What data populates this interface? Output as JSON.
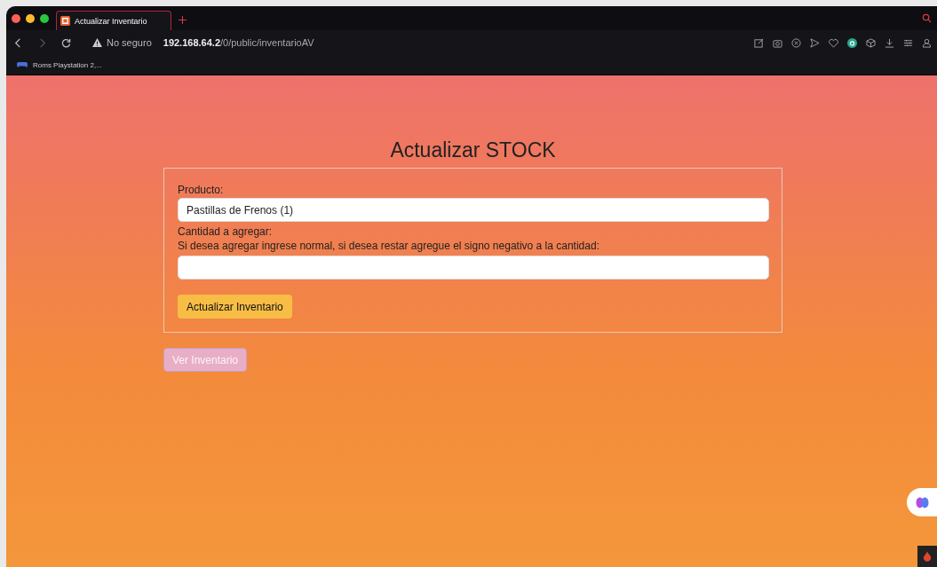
{
  "browser": {
    "tab": {
      "title": "Actualizar Inventario",
      "selected": true
    },
    "security": "No seguro",
    "url_host": "192.168.64.2",
    "url_path": "/0/public/inventarioAV",
    "bookmarks": [
      {
        "label": "Roms Playstation 2,..."
      }
    ]
  },
  "page": {
    "heading": "Actualizar STOCK",
    "form": {
      "product_label": "Producto:",
      "product_value": "Pastillas de Frenos (1)",
      "quantity_label": "Cantidad a agregar:",
      "quantity_hint": "Si desea agregar ingrese normal, si desea restar agregue el signo negativo a la cantidad:",
      "submit": "Actualizar Inventario"
    },
    "view_button": {
      "label": "Ver Inventario",
      "disabled": true
    }
  }
}
